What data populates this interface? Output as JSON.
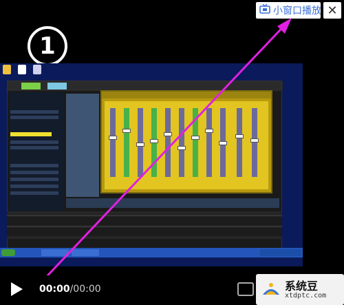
{
  "player": {
    "mini_window_label": "小窗口播放",
    "close_symbol": "✕",
    "step_marker": "①",
    "time": {
      "current": "00:00",
      "separator": "/",
      "duration": "00:00"
    },
    "watermark": {
      "title": "系统豆",
      "url": "xtdptc.com"
    }
  },
  "colors": {
    "accent": "#3a6fd8",
    "arrow": "#e020e0",
    "mixer": "#e2c520"
  },
  "icons": {
    "mini_window": "tv-icon",
    "play": "play-icon",
    "close": "close-icon"
  }
}
